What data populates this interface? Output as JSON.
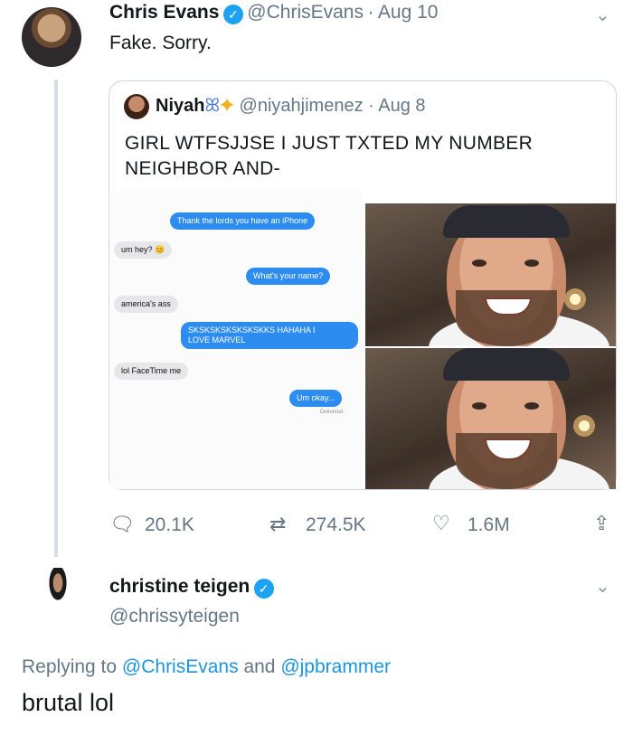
{
  "tweet": {
    "author_name": "Chris Evans",
    "handle": "@ChrisEvans",
    "separator": "·",
    "date": "Aug 10",
    "text": "Fake. Sorry.",
    "verified": true,
    "menu_icon": "chevron-down-icon"
  },
  "quote": {
    "author_name": "Niyah",
    "name_emojis": "butterfly, sparkles",
    "handle": "@niyahjimenez",
    "separator": "·",
    "date": "Aug 8",
    "text_line1": "GIRL WTFSJJSE I JUST TXTED MY NUMBER",
    "text_line2": "NEIGHBOR AND-",
    "chat": {
      "messages": [
        {
          "side": "right",
          "text": "Thank the lords you have an iPhone"
        },
        {
          "side": "left",
          "text": "um hey? 😊"
        },
        {
          "side": "right",
          "text": "What's your name?"
        },
        {
          "side": "left",
          "text": "america's ass"
        },
        {
          "side": "right",
          "text": "SKSKSKSKSKSKSKKS HAHAHA I",
          "text2": "LOVE MARVEL"
        },
        {
          "side": "left",
          "text": "lol FaceTime me"
        },
        {
          "side": "right",
          "text": "Um okay..."
        }
      ],
      "status": "Delivered"
    }
  },
  "actions": {
    "replies": "20.1K",
    "retweets": "274.5K",
    "likes": "1.6M"
  },
  "reply": {
    "author_name": "christine teigen",
    "handle": "@chrissyteigen",
    "verified": true,
    "context_prefix": "Replying to",
    "mention1": "@ChrisEvans",
    "context_and": "and",
    "mention2": "@jpbrammer",
    "text": "brutal lol"
  },
  "colors": {
    "accent": "#1da1f2",
    "mention": "#1b95e0",
    "muted": "#657786",
    "imessage_blue": "#2d8cf0"
  }
}
